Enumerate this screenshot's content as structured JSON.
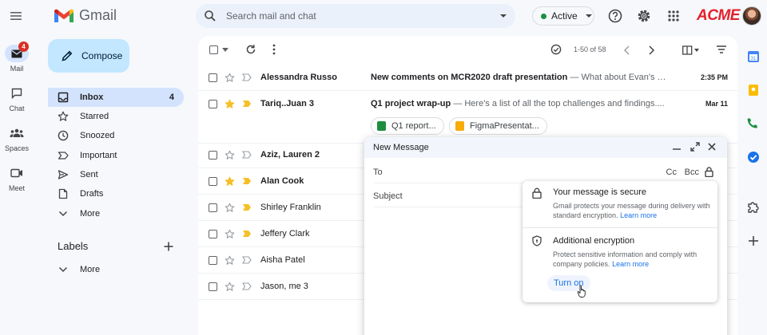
{
  "app": {
    "name": "Gmail",
    "org_logo": "ACME"
  },
  "search": {
    "placeholder": "Search mail and chat"
  },
  "status": {
    "label": "Active",
    "color": "#1e8e3e"
  },
  "rail": [
    {
      "label": "Mail",
      "icon": "mail-icon",
      "badge": "4",
      "active": true
    },
    {
      "label": "Chat",
      "icon": "chat-icon"
    },
    {
      "label": "Spaces",
      "icon": "spaces-icon"
    },
    {
      "label": "Meet",
      "icon": "meet-icon"
    }
  ],
  "compose_label": "Compose",
  "nav": [
    {
      "label": "Inbox",
      "icon": "inbox-icon",
      "count": "4",
      "active": true
    },
    {
      "label": "Starred",
      "icon": "star-icon"
    },
    {
      "label": "Snoozed",
      "icon": "clock-icon"
    },
    {
      "label": "Important",
      "icon": "important-icon"
    },
    {
      "label": "Sent",
      "icon": "send-icon"
    },
    {
      "label": "Drafts",
      "icon": "draft-icon"
    },
    {
      "label": "More",
      "icon": "chevron-down-icon"
    }
  ],
  "labels": {
    "title": "Labels",
    "more": "More"
  },
  "toolbar": {
    "pager": "1-50 of 58"
  },
  "emails": [
    {
      "sender": "Alessandra Russo",
      "subject": "New comments on MCR2020 draft presentation",
      "snippet": " — What about Evan's t...",
      "date": "2:35 PM",
      "unread": true,
      "starred": false,
      "important": false
    },
    {
      "sender": "Tariq..Juan 3",
      "subject": "Q1 project wrap-up",
      "snippet": " — Here's a list of all the top challenges and findings....",
      "date": "Mar 11",
      "unread": true,
      "starred": true,
      "important": true
    },
    {
      "sender": "Aziz, Lauren 2",
      "subject": "",
      "snippet": "",
      "date": "",
      "unread": true,
      "starred": false,
      "important": false
    },
    {
      "sender": "Alan Cook",
      "subject": "",
      "snippet": "",
      "date": "",
      "unread": true,
      "starred": true,
      "important": true
    },
    {
      "sender": "Shirley Franklin",
      "subject": "",
      "snippet": "",
      "date": "",
      "unread": false,
      "starred": false,
      "important": true
    },
    {
      "sender": "Jeffery Clark",
      "subject": "",
      "snippet": "",
      "date": "",
      "unread": false,
      "starred": false,
      "important": true
    },
    {
      "sender": "Aisha Patel",
      "subject": "",
      "snippet": "",
      "date": "",
      "unread": false,
      "starred": false,
      "important": false
    },
    {
      "sender": "Jason, me 3",
      "subject": "",
      "snippet": "",
      "date": "",
      "unread": false,
      "starred": false,
      "important": false
    }
  ],
  "attachments": [
    {
      "name": "Q1 report...",
      "color": "#1e8e3e"
    },
    {
      "name": "FigmaPresentat...",
      "color": "#f9ab00"
    }
  ],
  "compose_window": {
    "title": "New Message",
    "to_label": "To",
    "cc_label": "Cc",
    "bcc_label": "Bcc",
    "subject_label": "Subject"
  },
  "encryption": {
    "secure_title": "Your message is secure",
    "secure_text": "Gmail protects your message during delivery with standard encryption.",
    "learn_more": "Learn more",
    "additional_title": "Additional encryption",
    "additional_text": "Protect sensitive information and comply with company policies.",
    "turn_on": "Turn on"
  },
  "colors": {
    "accent": "#1a73e8",
    "star": "#f6bf26",
    "important": "#f6bf26",
    "compose_bg": "#c2e7ff",
    "active_nav": "#d3e3fd"
  }
}
